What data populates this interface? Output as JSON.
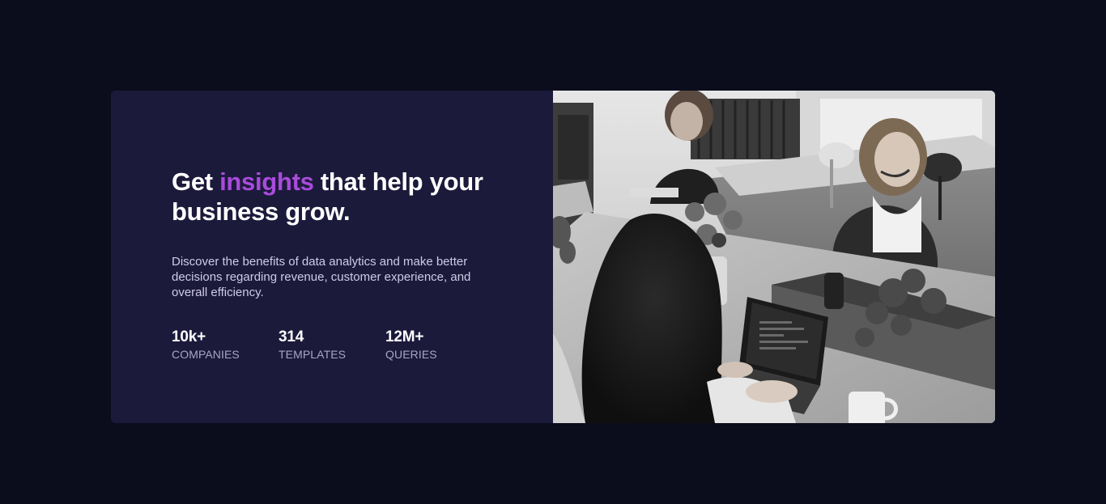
{
  "hero": {
    "headline": {
      "before": "Get ",
      "accent": "insights",
      "after": " that help your business grow."
    },
    "description": "Discover the benefits of data analytics and make better decisions regarding revenue, customer experience, and overall efficiency.",
    "stats": [
      {
        "value": "10k+",
        "label": "COMPANIES"
      },
      {
        "value": "314",
        "label": "TEMPLATES"
      },
      {
        "value": "12M+",
        "label": "QUERIES"
      }
    ]
  },
  "colors": {
    "page_background": "#0b0d1d",
    "card_background": "#1c1a3b",
    "accent": "#a94bdb",
    "heading": "#ffffff",
    "body_text": "#cfcbe6",
    "stat_label": "#a9a6c2"
  }
}
